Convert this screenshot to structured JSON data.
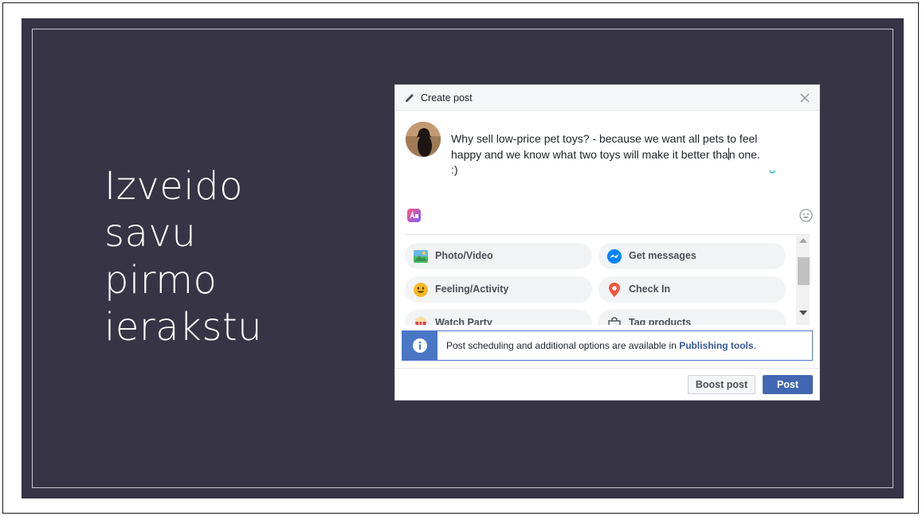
{
  "slide": {
    "title_lines": [
      "Izveido",
      "savu",
      "pirmo",
      "ierakstu"
    ],
    "background": "#373445"
  },
  "dialog": {
    "header": {
      "title": "Create post"
    },
    "post": {
      "line1": "Why sell low-price pet toys? - because we want all pets to feel",
      "line2_before_caret": "happy and we know what two toys will make it better tha",
      "line2_after_caret": "n one.",
      "line3": ":)"
    },
    "options": [
      {
        "label": "Photo/Video",
        "icon": "photo-video-icon"
      },
      {
        "label": "Get messages",
        "icon": "messenger-icon"
      },
      {
        "label": "Feeling/Activity",
        "icon": "smiley-icon"
      },
      {
        "label": "Check In",
        "icon": "location-pin-icon"
      },
      {
        "label": "Watch Party",
        "icon": "popcorn-icon"
      },
      {
        "label": "Tag products",
        "icon": "shopping-bag-icon"
      }
    ],
    "info": {
      "text": "Post scheduling and additional options are available in ",
      "link": "Publishing tools",
      "suffix": "."
    },
    "footer": {
      "boost_label": "Boost post",
      "post_label": "Post"
    },
    "colors": {
      "accent": "#4267b2",
      "info_blue": "#4a76c6"
    }
  }
}
